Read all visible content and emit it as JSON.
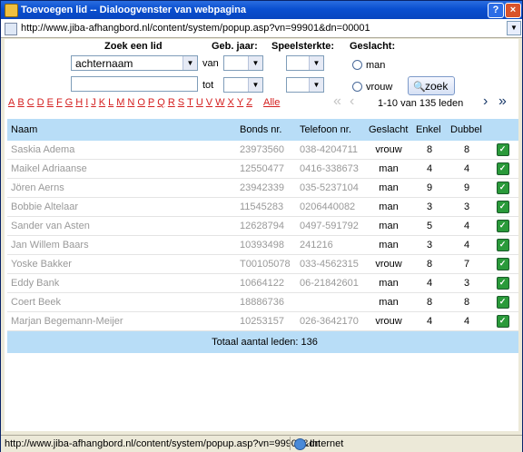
{
  "window": {
    "title": "Toevoegen lid -- Dialoogvenster van webpagina",
    "address": "http://www.jiba-afhangbord.nl/content/system/popup.asp?vn=99901&dn=00001"
  },
  "search": {
    "zoek_label": "Zoek een lid",
    "field_select": "achternaam",
    "geb_label": "Geb. jaar:",
    "van_label": "van",
    "tot_label": "tot",
    "speel_label": "Speelsterkte:",
    "geslacht_label": "Geslacht:",
    "radio_man": "man",
    "radio_vrouw": "vrouw",
    "zoek_button": "zoek"
  },
  "alphabet": [
    "A",
    "B",
    "C",
    "D",
    "E",
    "F",
    "G",
    "H",
    "I",
    "J",
    "K",
    "L",
    "M",
    "N",
    "O",
    "P",
    "Q",
    "R",
    "S",
    "T",
    "U",
    "V",
    "W",
    "X",
    "Y",
    "Z"
  ],
  "alle_label": "Alle",
  "pager": {
    "text": "1-10 van 135 leden"
  },
  "table": {
    "headers": [
      "Naam",
      "Bonds nr.",
      "Telefoon nr.",
      "Geslacht",
      "Enkel",
      "Dubbel"
    ],
    "rows": [
      {
        "naam": "Saskia Adema",
        "bonds": "23973560",
        "tel": "038-4204711",
        "geslacht": "vrouw",
        "enkel": "8",
        "dubbel": "8"
      },
      {
        "naam": "Maikel Adriaanse",
        "bonds": "12550477",
        "tel": "0416-338673",
        "geslacht": "man",
        "enkel": "4",
        "dubbel": "4"
      },
      {
        "naam": "Jören Aerns",
        "bonds": "23942339",
        "tel": "035-5237104",
        "geslacht": "man",
        "enkel": "9",
        "dubbel": "9"
      },
      {
        "naam": "Bobbie Altelaar",
        "bonds": "11545283",
        "tel": "0206440082",
        "geslacht": "man",
        "enkel": "3",
        "dubbel": "3"
      },
      {
        "naam": "Sander van Asten",
        "bonds": "12628794",
        "tel": "0497-591792",
        "geslacht": "man",
        "enkel": "5",
        "dubbel": "4"
      },
      {
        "naam": "Jan Willem Baars",
        "bonds": "10393498",
        "tel": "241216",
        "geslacht": "man",
        "enkel": "3",
        "dubbel": "4"
      },
      {
        "naam": "Yoske Bakker",
        "bonds": "T00105078",
        "tel": "033-4562315",
        "geslacht": "vrouw",
        "enkel": "8",
        "dubbel": "7"
      },
      {
        "naam": "Eddy Bank",
        "bonds": "10664122",
        "tel": "06-21842601",
        "geslacht": "man",
        "enkel": "4",
        "dubbel": "3"
      },
      {
        "naam": "Coert Beek",
        "bonds": "18886736",
        "tel": "",
        "geslacht": "man",
        "enkel": "8",
        "dubbel": "8"
      },
      {
        "naam": "Marjan Begemann-Meijer",
        "bonds": "10253157",
        "tel": "026-3642170",
        "geslacht": "vrouw",
        "enkel": "4",
        "dubbel": "4"
      }
    ],
    "footer": "Totaal aantal leden: 136"
  },
  "status": {
    "url": "http://www.jiba-afhangbord.nl/content/system/popup.asp?vn=99901&dn",
    "zone": "Internet"
  }
}
